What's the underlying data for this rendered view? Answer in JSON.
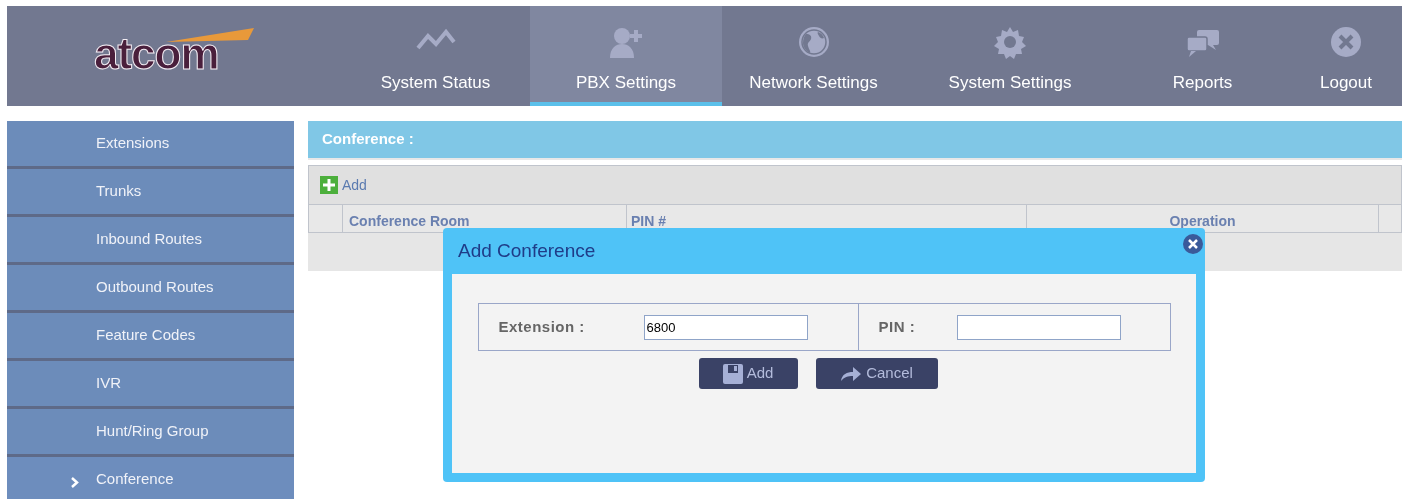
{
  "header": {
    "logo": "atcom"
  },
  "nav": [
    {
      "label": "System Status",
      "selected": false
    },
    {
      "label": "PBX Settings",
      "selected": true
    },
    {
      "label": "Network Settings",
      "selected": false
    },
    {
      "label": "System Settings",
      "selected": false
    },
    {
      "label": "Reports",
      "selected": false
    },
    {
      "label": "Logout",
      "selected": false
    }
  ],
  "sidebar": {
    "items": [
      {
        "label": "Extensions",
        "selected": false
      },
      {
        "label": "Trunks",
        "selected": false
      },
      {
        "label": "Inbound Routes",
        "selected": false
      },
      {
        "label": "Outbound Routes",
        "selected": false
      },
      {
        "label": "Feature Codes",
        "selected": false
      },
      {
        "label": "IVR",
        "selected": false
      },
      {
        "label": "Hunt/Ring Group",
        "selected": false
      },
      {
        "label": "Conference",
        "selected": true
      }
    ]
  },
  "panel": {
    "title": "Conference :",
    "add_label": "Add",
    "table": {
      "columns": [
        "Conference Room",
        "PIN #",
        "Operation"
      ]
    }
  },
  "dialog": {
    "title": "Add Conference",
    "fields": [
      {
        "label": "Extension :",
        "value": "6800"
      },
      {
        "label": "PIN :"
      }
    ],
    "buttons": [
      "Add",
      "Cancel"
    ]
  }
}
